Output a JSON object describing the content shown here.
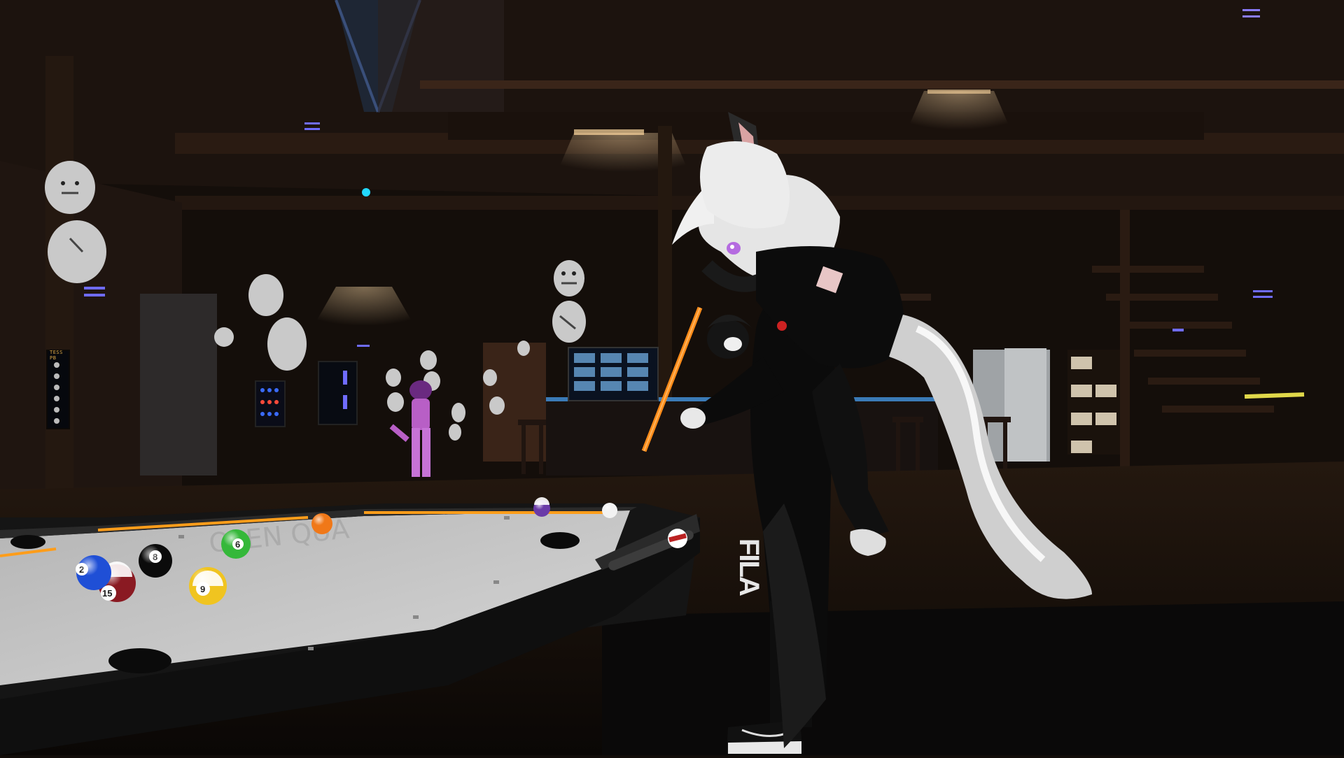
{
  "scene": {
    "setting": "VR social world — bar / pool hall interior",
    "colors": {
      "wood_dark": "#1a120d",
      "wood_mid": "#2b1d15",
      "felt": "#c9c9c9",
      "rail_light": "#ff9d1a",
      "neon_accent": "#6f6cff",
      "cyan_light": "#22d8ff"
    }
  },
  "wall_panel": {
    "title": "TESS PB",
    "button_count": 6
  },
  "pool_table": {
    "balls": [
      {
        "name": "8-ball",
        "label": "8",
        "color": "#0b0b0b"
      },
      {
        "name": "9-ball",
        "label": "9",
        "color": "#f0c420"
      },
      {
        "name": "15-ball",
        "label": "15",
        "color": "#8a1a22"
      },
      {
        "name": "2-ball",
        "label": "2",
        "color": "#1f4fd6"
      },
      {
        "name": "6-ball",
        "label": "6",
        "color": "#35b83a"
      },
      {
        "name": "5-ball",
        "label": "",
        "color": "#f07818"
      },
      {
        "name": "12-ball",
        "label": "",
        "color": "#6a3aa8"
      },
      {
        "name": "cue-ball",
        "label": "",
        "color": "#f2f2f2"
      }
    ]
  },
  "avatar": {
    "shirt_logo": "FILA",
    "cue_color": "#ff8c1a"
  }
}
